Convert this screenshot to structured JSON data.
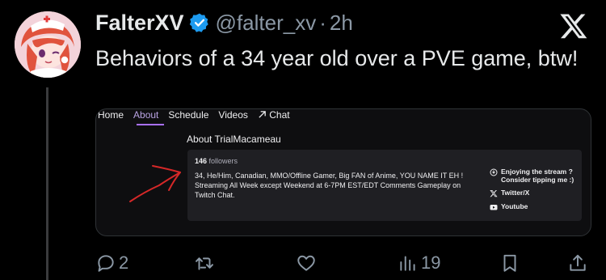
{
  "tweet": {
    "display_name": "FalterXV",
    "handle": "@falter_xv",
    "separator": "·",
    "time": "2h",
    "text": "Behaviors of a 34 year old over a PVE game, btw!",
    "colors": {
      "background": "#000000",
      "text": "#e7e9ea",
      "muted": "#8b98a5",
      "verified": "#1d9bf0"
    }
  },
  "embed": {
    "tabs": [
      {
        "label": "Home"
      },
      {
        "label": "About",
        "active": true
      },
      {
        "label": "Schedule"
      },
      {
        "label": "Videos"
      },
      {
        "label": "Chat",
        "icon": "external-arrow-icon"
      }
    ],
    "about_title": "About TrialMacameau",
    "followers_count": "146",
    "followers_label": "followers",
    "bio": "34, He/Him, Canadian, MMO/Offline Gamer, Big FAN of Anime, YOU NAME IT EH ! Streaming All Week except Weekend at 6-7PM EST/EDT Comments Gameplay on Twitch Chat.",
    "links": [
      {
        "label": "Enjoying the stream ? Consider tipping me :)",
        "icon": "tip-icon"
      },
      {
        "label": "Twitter/X",
        "icon": "x-icon"
      },
      {
        "label": "Youtube",
        "icon": "youtube-icon"
      }
    ],
    "accent_color": "#a970ff",
    "annotation_color": "#d62828"
  },
  "actions": {
    "replies": "2",
    "retweets": "",
    "likes": "",
    "views": "19"
  }
}
